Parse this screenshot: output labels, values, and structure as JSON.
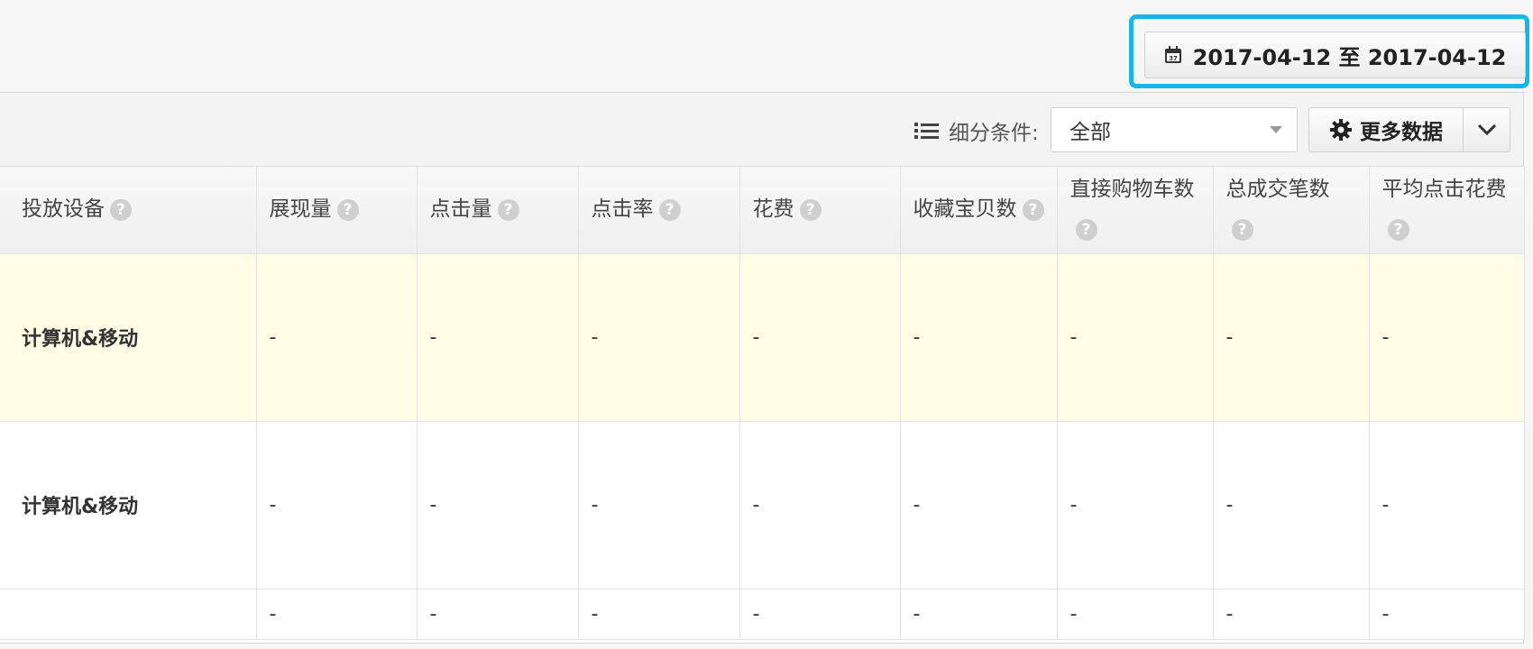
{
  "date_range": {
    "label": "2017-04-12 至 2017-04-12",
    "highlight_color": "#18b5e8",
    "icon": "calendar-icon"
  },
  "toolbar": {
    "filter_label": "细分条件:",
    "filter_value": "全部",
    "more_data_label": "更多数据",
    "icons": [
      "list-icon",
      "gear-icon",
      "chevron-down-icon"
    ]
  },
  "table": {
    "headers": [
      "投放设备",
      "展现量",
      "点击量",
      "点击率",
      "花费",
      "收藏宝贝数",
      "直接购物车数",
      "总成交笔数",
      "平均点击花费"
    ],
    "rows": [
      [
        "计算机&移动",
        "-",
        "-",
        "-",
        "-",
        "-",
        "-",
        "-",
        "-"
      ],
      [
        "计算机&移动",
        "-",
        "-",
        "-",
        "-",
        "-",
        "-",
        "-",
        "-"
      ],
      [
        "",
        "-",
        "-",
        "-",
        "-",
        "-",
        "-",
        "-",
        "-"
      ]
    ],
    "highlight_row_color": "#fffde6"
  }
}
